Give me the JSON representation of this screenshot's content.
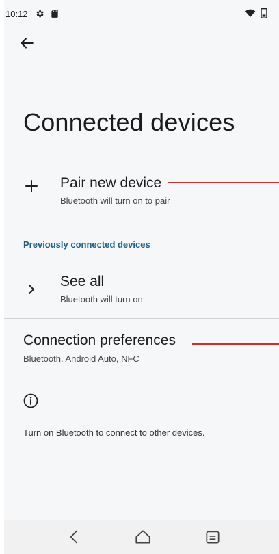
{
  "status_bar": {
    "time": "10:12",
    "icons": [
      "gear-icon",
      "sd-card-icon",
      "wifi-icon",
      "battery-icon"
    ]
  },
  "header": {
    "back_icon": "arrow-back-icon"
  },
  "page": {
    "title": "Connected devices"
  },
  "pair_new_device": {
    "icon": "plus-icon",
    "title": "Pair new device",
    "subtitle": "Bluetooth will turn on to pair"
  },
  "previously_connected": {
    "header": "Previously connected devices",
    "see_all": {
      "icon": "chevron-right-icon",
      "title": "See all",
      "subtitle": "Bluetooth will turn on"
    }
  },
  "connection_preferences": {
    "title": "Connection preferences",
    "subtitle": "Bluetooth, Android Auto, NFC"
  },
  "info": {
    "icon": "info-icon",
    "text": "Turn on Bluetooth to connect to other devices."
  },
  "nav_bar": {
    "buttons": [
      "back-nav-icon",
      "home-nav-icon",
      "recents-nav-icon"
    ]
  },
  "colors": {
    "background": "#f6f7f9",
    "section_header": "#1f5f8b",
    "annotation_line": "#d32f2f",
    "nav_bar": "#f1f1f1"
  }
}
